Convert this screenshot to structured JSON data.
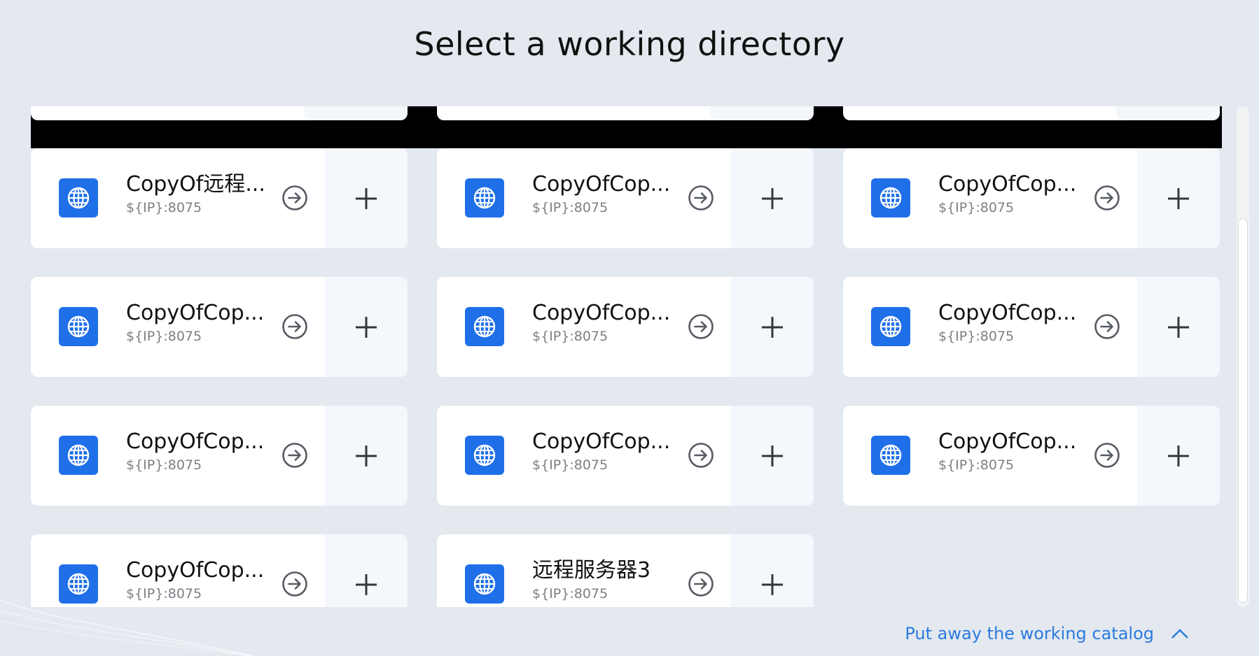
{
  "title": "Select a working directory",
  "cards": [
    {
      "name": "CopyOf远程...",
      "address": "${IP}:8075"
    },
    {
      "name": "CopyOfCop...",
      "address": "${IP}:8075"
    },
    {
      "name": "CopyOfCop...",
      "address": "${IP}:8075"
    },
    {
      "name": "CopyOfCop...",
      "address": "${IP}:8075"
    },
    {
      "name": "CopyOfCop...",
      "address": "${IP}:8075"
    },
    {
      "name": "CopyOfCop...",
      "address": "${IP}:8075"
    },
    {
      "name": "CopyOfCop...",
      "address": "${IP}:8075"
    },
    {
      "name": "CopyOfCop...",
      "address": "${IP}:8075"
    },
    {
      "name": "CopyOfCop...",
      "address": "${IP}:8075"
    },
    {
      "name": "CopyOfCop...",
      "address": "${IP}:8075"
    },
    {
      "name": "远程服务器3",
      "address": "${IP}:8075"
    }
  ],
  "icons": {
    "server": "globe-icon",
    "enter": "arrow-right-circle-icon",
    "add": "plus-icon",
    "collapse": "chevron-up-icon"
  },
  "colors": {
    "accent": "#1f6fe8",
    "link": "#2a7be0",
    "background": "#e4e8ef"
  },
  "footer": {
    "collapse_label": "Put away the working catalog"
  }
}
